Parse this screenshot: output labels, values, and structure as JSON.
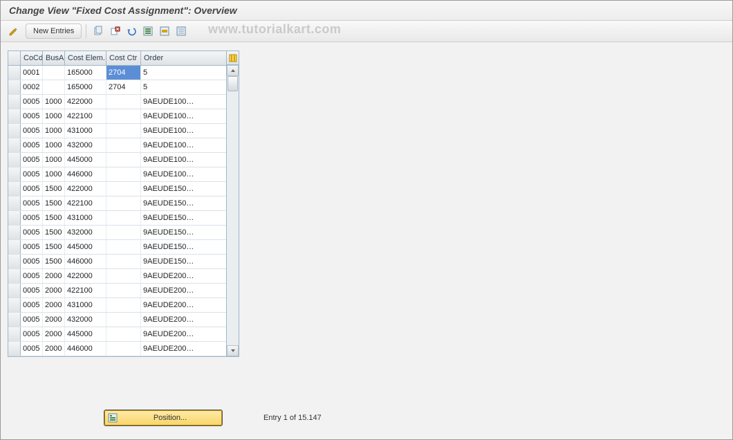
{
  "title": "Change View \"Fixed Cost Assignment\": Overview",
  "watermark": "www.tutorialkart.com",
  "toolbar": {
    "new_entries_label": "New Entries"
  },
  "columns": {
    "cocd": "CoCd",
    "busa": "BusA",
    "cost_elem": "Cost Elem.",
    "cost_ctr": "Cost Ctr",
    "order": "Order"
  },
  "rows": [
    {
      "cocd": "0001",
      "busa": "",
      "ce": "165000",
      "cc": "2704",
      "ord": "5",
      "hl": true
    },
    {
      "cocd": "0002",
      "busa": "",
      "ce": "165000",
      "cc": "2704",
      "ord": "5"
    },
    {
      "cocd": "0005",
      "busa": "1000",
      "ce": "422000",
      "cc": "",
      "ord": "9AEUDE100…"
    },
    {
      "cocd": "0005",
      "busa": "1000",
      "ce": "422100",
      "cc": "",
      "ord": "9AEUDE100…"
    },
    {
      "cocd": "0005",
      "busa": "1000",
      "ce": "431000",
      "cc": "",
      "ord": "9AEUDE100…"
    },
    {
      "cocd": "0005",
      "busa": "1000",
      "ce": "432000",
      "cc": "",
      "ord": "9AEUDE100…"
    },
    {
      "cocd": "0005",
      "busa": "1000",
      "ce": "445000",
      "cc": "",
      "ord": "9AEUDE100…"
    },
    {
      "cocd": "0005",
      "busa": "1000",
      "ce": "446000",
      "cc": "",
      "ord": "9AEUDE100…"
    },
    {
      "cocd": "0005",
      "busa": "1500",
      "ce": "422000",
      "cc": "",
      "ord": "9AEUDE150…"
    },
    {
      "cocd": "0005",
      "busa": "1500",
      "ce": "422100",
      "cc": "",
      "ord": "9AEUDE150…"
    },
    {
      "cocd": "0005",
      "busa": "1500",
      "ce": "431000",
      "cc": "",
      "ord": "9AEUDE150…"
    },
    {
      "cocd": "0005",
      "busa": "1500",
      "ce": "432000",
      "cc": "",
      "ord": "9AEUDE150…"
    },
    {
      "cocd": "0005",
      "busa": "1500",
      "ce": "445000",
      "cc": "",
      "ord": "9AEUDE150…"
    },
    {
      "cocd": "0005",
      "busa": "1500",
      "ce": "446000",
      "cc": "",
      "ord": "9AEUDE150…"
    },
    {
      "cocd": "0005",
      "busa": "2000",
      "ce": "422000",
      "cc": "",
      "ord": "9AEUDE200…"
    },
    {
      "cocd": "0005",
      "busa": "2000",
      "ce": "422100",
      "cc": "",
      "ord": "9AEUDE200…"
    },
    {
      "cocd": "0005",
      "busa": "2000",
      "ce": "431000",
      "cc": "",
      "ord": "9AEUDE200…"
    },
    {
      "cocd": "0005",
      "busa": "2000",
      "ce": "432000",
      "cc": "",
      "ord": "9AEUDE200…"
    },
    {
      "cocd": "0005",
      "busa": "2000",
      "ce": "445000",
      "cc": "",
      "ord": "9AEUDE200…"
    },
    {
      "cocd": "0005",
      "busa": "2000",
      "ce": "446000",
      "cc": "",
      "ord": "9AEUDE200…"
    }
  ],
  "footer": {
    "position_label": "Position...",
    "entry_text": "Entry 1 of 15.147"
  },
  "icons": {
    "toggle": "toggle-display-change-icon",
    "copy": "copy-icon",
    "delete": "delete-icon",
    "undo": "undo-icon",
    "select_all": "select-all-icon",
    "select_block": "select-block-icon",
    "deselect": "deselect-all-icon",
    "config": "configure-columns-icon",
    "pos_icon": "position-icon"
  }
}
